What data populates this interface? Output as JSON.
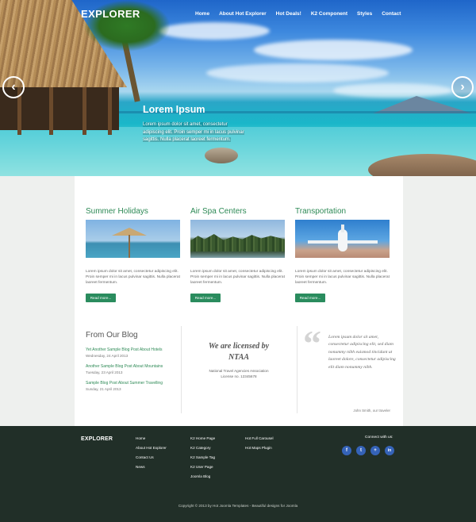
{
  "header": {
    "logo": "EXPLORER",
    "nav": [
      "Home",
      "About Hot Explorer",
      "Hot Deals!",
      "K2 Component",
      "Styles",
      "Contact"
    ]
  },
  "slider": {
    "title": "Lorem Ipsum",
    "text": "Lorem ipsum dolor sit amet, consectetur adipiscing elit. Proin semper mi in lacus pulvinar sagittis. Nulla placerat laoreet fermentum.",
    "prev_icon": "chevron-left-icon",
    "next_icon": "chevron-right-icon"
  },
  "features": [
    {
      "title": "Summer Holidays",
      "text": "Lorem ipsum dolor sit amet, consectetur adipiscing elit. Proin semper mi in lacus pulvinar sagittis. Nulla placerat laoreet fermentum.",
      "button": "Read more..."
    },
    {
      "title": "Air Spa Centers",
      "text": "Lorem ipsum dolor sit amet, consectetur adipiscing elit. Proin semper mi in lacus pulvinar sagittis. Nulla placerat laoreet fermentum.",
      "button": "Read more..."
    },
    {
      "title": "Transportation",
      "text": "Lorem ipsum dolor sit amet, consectetur adipiscing elit. Proin semper mi in lacus pulvinar sagittis. Nulla placerat laoreet fermentum.",
      "button": "Read more..."
    }
  ],
  "blog": {
    "title": "From Our Blog",
    "posts": [
      {
        "title": "Yet Another Sample Blog Post About Hotels",
        "date": "Wednesday, 24 April 2013"
      },
      {
        "title": "Another Sample Blog Post About Mountains",
        "date": "Tuesday, 23 April 2013"
      },
      {
        "title": "Sample Blog Post About Summer Travelling",
        "date": "Sunday, 21 April 2013"
      }
    ]
  },
  "license": {
    "heading_line1": "We are licensed by",
    "heading_line2": "NTAA",
    "assoc": "National Travel Agencies Association",
    "license_no": "License no. 12345678"
  },
  "testimonial": {
    "quote": "Lorem ipsum dolor sit amet, consectetur adipiscing elit, sed diam nonummy nibh euismod tincidunt ut laoreet dolore, consectetur adipiscing elit diam nonummy nibh.",
    "author": "John Smith, our traveler"
  },
  "footer": {
    "logo": "EXPLORER",
    "col1": [
      "Home",
      "About Hot Explorer",
      "Contact Us",
      "News"
    ],
    "col2": [
      "K2 Home Page",
      "K2 Category",
      "K2 Sample Tag",
      "K2 User Page",
      "Joomla Blog"
    ],
    "col3": [
      "Hot Full Carousel",
      "Hot Maps Plugin"
    ],
    "connect": "Connect with us:",
    "social": [
      {
        "icon": "facebook-icon",
        "glyph": "f"
      },
      {
        "icon": "twitter-icon",
        "glyph": "t"
      },
      {
        "icon": "google-plus-icon",
        "glyph": "+"
      },
      {
        "icon": "linkedin-icon",
        "glyph": "in"
      }
    ],
    "copyright": "Copyright © 2013 by Hot Joomla Templates - Beautiful designs for Joomla"
  },
  "colors": {
    "accent": "#2a8c5e",
    "footer_bg": "#212f28",
    "social": "#3563b8"
  }
}
